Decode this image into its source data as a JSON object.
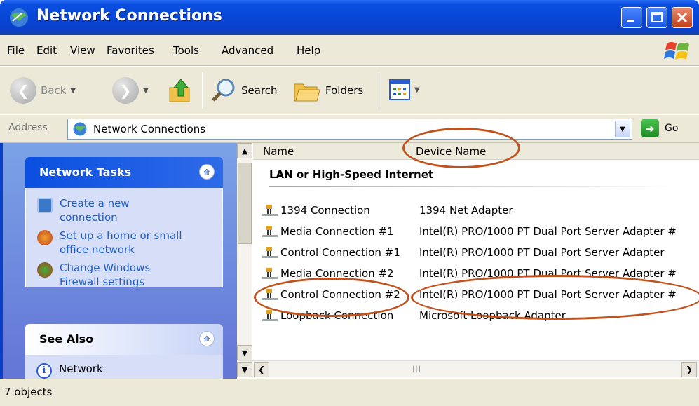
{
  "window": {
    "title": "Network Connections"
  },
  "menu": {
    "items": [
      {
        "label": "File",
        "u": "F",
        "rest": "ile"
      },
      {
        "label": "Edit",
        "u": "E",
        "rest": "dit"
      },
      {
        "label": "View",
        "u": "V",
        "rest": "iew"
      },
      {
        "label": "Favorites",
        "pre": "F",
        "u": "a",
        "rest": "vorites"
      },
      {
        "label": "Tools",
        "u": "T",
        "rest": "ools"
      },
      {
        "label": "Advanced",
        "pre": "Adva",
        "u": "n",
        "rest": "ced"
      },
      {
        "label": "Help",
        "u": "H",
        "rest": "elp"
      }
    ]
  },
  "toolbar": {
    "back_label": "Back",
    "search_label": "Search",
    "folders_label": "Folders"
  },
  "address": {
    "label": "Address",
    "value": "Network Connections",
    "go_label": "Go"
  },
  "left_pane": {
    "network_tasks": {
      "title": "Network Tasks",
      "tasks": [
        {
          "line1": "Create a new",
          "line2": "connection",
          "icon": "new-connection-icon"
        },
        {
          "line1": "Set up a home or small",
          "line2": "office network",
          "icon": "home-network-icon"
        },
        {
          "line1": "Change Windows",
          "line2": "Firewall settings",
          "icon": "firewall-icon"
        }
      ]
    },
    "see_also": {
      "title": "See Also",
      "items": [
        {
          "label": "Network",
          "icon": "info-icon"
        }
      ]
    }
  },
  "content": {
    "columns": {
      "name": "Name",
      "device": "Device Name"
    },
    "group_title": "LAN or High-Speed Internet",
    "rows": [
      {
        "name": "1394 Connection",
        "device": "1394 Net Adapter"
      },
      {
        "name": "Media Connection #1",
        "device": "Intel(R) PRO/1000 PT Dual Port Server Adapter #"
      },
      {
        "name": "Control Connection #1",
        "device": "Intel(R) PRO/1000 PT Dual Port Server Adapter"
      },
      {
        "name": "Media Connection #2",
        "device": "Intel(R) PRO/1000 PT Dual Port Server Adapter #"
      },
      {
        "name": "Control Connection #2",
        "device": "Intel(R) PRO/1000 PT Dual Port Server Adapter #"
      },
      {
        "name": "Loopback Connection",
        "device": "Microsoft Loopback Adapter"
      }
    ]
  },
  "status": {
    "text": "7 objects"
  },
  "colors": {
    "title_bar": "#0a4fe0",
    "task_link": "#215dc6",
    "annotation": "#c0521e"
  }
}
